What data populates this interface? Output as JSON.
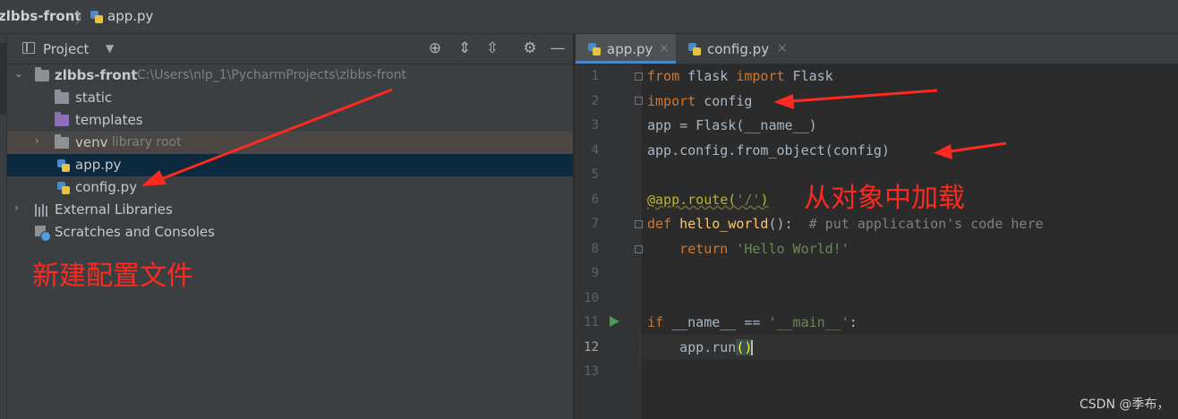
{
  "navbar": {
    "project": "zlbbs-front",
    "separator": "〉",
    "file": "app.py"
  },
  "project_panel": {
    "title": "Project",
    "tree": [
      {
        "label": "zlbbs-front",
        "sub": "C:\\Users\\nlp_1\\PycharmProjects\\zlbbs-front"
      },
      {
        "label": "static"
      },
      {
        "label": "templates"
      },
      {
        "label": "venv",
        "sub": "library root"
      },
      {
        "label": "app.py"
      },
      {
        "label": "config.py"
      },
      {
        "label": "External Libraries"
      },
      {
        "label": "Scratches and Consoles"
      }
    ]
  },
  "editor": {
    "tabs": [
      {
        "label": "app.py",
        "close": "×"
      },
      {
        "label": "config.py",
        "close": "×"
      }
    ],
    "line_numbers": [
      "1",
      "2",
      "3",
      "4",
      "5",
      "6",
      "7",
      "8",
      "9",
      "10",
      "11",
      "12",
      "13"
    ],
    "code": {
      "l1a": "from",
      "l1b": " flask ",
      "l1c": "import",
      "l1d": " Flask",
      "l2a": "import",
      "l2b": " config",
      "l3": "app = Flask(__name__)",
      "l4": "app.config.from_object(config)",
      "l6a": "@app.route(",
      "l6b": "'/'",
      "l6c": ")",
      "l7a": "def",
      "l7b": " ",
      "l7c": "hello_world",
      "l7d": "():  ",
      "l7e": "# put application's code here",
      "l8a": "    ",
      "l8b": "return",
      "l8c": " ",
      "l8d": "'Hello World!'",
      "l11a": "if",
      "l11b": " __name__ == ",
      "l11c": "'__main__'",
      "l11d": ":",
      "l12a": "    app.run",
      "l12b": "()"
    }
  },
  "annotations": {
    "left": "新建配置文件",
    "right": "从对象中加载",
    "color": "#ff2a1f"
  },
  "watermark": "CSDN @季布，"
}
